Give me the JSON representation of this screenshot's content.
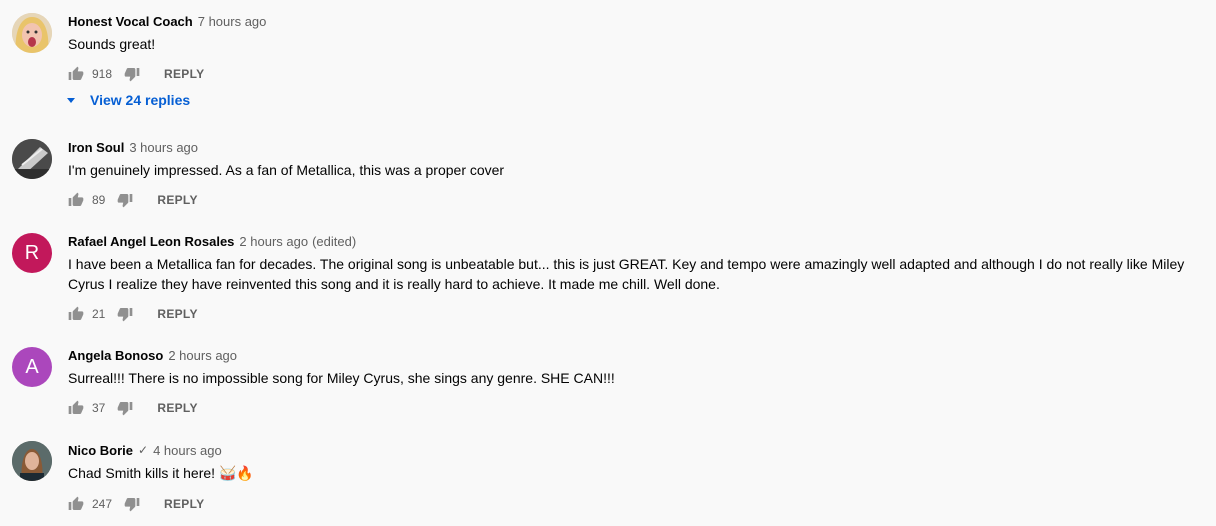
{
  "comments": [
    {
      "author": "Honest Vocal Coach",
      "verified": false,
      "time": "7 hours ago",
      "edited": "",
      "text": "Sounds great!",
      "likes": "918",
      "reply_label": "REPLY",
      "view_replies": "View 24 replies",
      "avatar": {
        "type": "photo",
        "icon": "vocal-coach-photo"
      }
    },
    {
      "author": "Iron Soul",
      "verified": false,
      "time": "3 hours ago",
      "edited": "",
      "text": "I'm genuinely impressed. As a fan of Metallica, this was a proper cover",
      "likes": "89",
      "reply_label": "REPLY",
      "avatar": {
        "type": "photo",
        "icon": "iron-soul-photo"
      }
    },
    {
      "author": "Rafael Angel Leon Rosales",
      "verified": false,
      "time": "2 hours ago",
      "edited": "(edited)",
      "text": "I have been a Metallica fan for decades. The original song is unbeatable but... this is just GREAT. Key and tempo were amazingly well adapted and although I do not really like Miley Cyrus I realize they have reinvented this song and it is really hard to achieve. It made me chill.  Well done.",
      "likes": "21",
      "reply_label": "REPLY",
      "avatar": {
        "type": "letter",
        "letter": "R",
        "color": "#c2185b"
      }
    },
    {
      "author": "Angela Bonoso",
      "verified": false,
      "time": "2 hours ago",
      "edited": "",
      "text": "Surreal!!! There is no impossible song for Miley Cyrus, she sings any genre. SHE CAN!!!",
      "likes": "37",
      "reply_label": "REPLY",
      "avatar": {
        "type": "letter",
        "letter": "A",
        "color": "#ab47bc"
      }
    },
    {
      "author": "Nico Borie",
      "verified": true,
      "verified_glyph": "✓",
      "time": "4 hours ago",
      "edited": "",
      "text": "Chad Smith kills it here! 🥁🔥",
      "likes": "247",
      "reply_label": "REPLY",
      "avatar": {
        "type": "photo",
        "icon": "nico-borie-photo"
      }
    }
  ],
  "colors": {
    "background": "#f9f9f9",
    "link_blue": "#065fd4",
    "secondary_text": "#606060"
  }
}
